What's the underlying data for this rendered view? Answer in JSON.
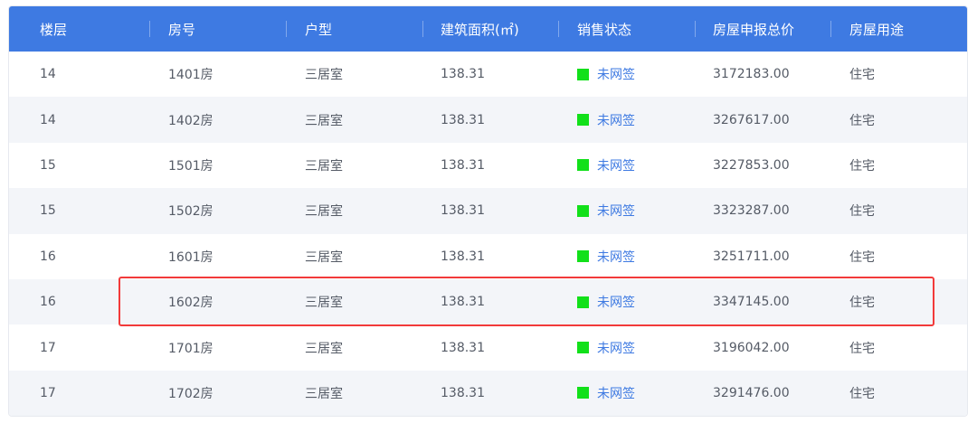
{
  "table": {
    "headers": [
      "楼层",
      "房号",
      "户型",
      "建筑面积(㎡)",
      "销售状态",
      "房屋申报总价",
      "房屋用途"
    ],
    "rows": [
      {
        "floor": "14",
        "room": "1401房",
        "layout": "三居室",
        "area": "138.31",
        "status": "未网签",
        "price": "3172183.00",
        "usage": "住宅"
      },
      {
        "floor": "14",
        "room": "1402房",
        "layout": "三居室",
        "area": "138.31",
        "status": "未网签",
        "price": "3267617.00",
        "usage": "住宅"
      },
      {
        "floor": "15",
        "room": "1501房",
        "layout": "三居室",
        "area": "138.31",
        "status": "未网签",
        "price": "3227853.00",
        "usage": "住宅"
      },
      {
        "floor": "15",
        "room": "1502房",
        "layout": "三居室",
        "area": "138.31",
        "status": "未网签",
        "price": "3323287.00",
        "usage": "住宅"
      },
      {
        "floor": "16",
        "room": "1601房",
        "layout": "三居室",
        "area": "138.31",
        "status": "未网签",
        "price": "3251711.00",
        "usage": "住宅"
      },
      {
        "floor": "16",
        "room": "1602房",
        "layout": "三居室",
        "area": "138.31",
        "status": "未网签",
        "price": "3347145.00",
        "usage": "住宅"
      },
      {
        "floor": "17",
        "room": "1701房",
        "layout": "三居室",
        "area": "138.31",
        "status": "未网签",
        "price": "3196042.00",
        "usage": "住宅"
      },
      {
        "floor": "17",
        "room": "1702房",
        "layout": "三居室",
        "area": "138.31",
        "status": "未网签",
        "price": "3291476.00",
        "usage": "住宅"
      }
    ]
  },
  "colors": {
    "header_bg": "#3e7ae2",
    "alt_row_bg": "#f3f5f9",
    "status_square": "#12e01a",
    "status_text": "#3e7ae2",
    "highlight_border": "#f23a3a"
  },
  "highlight": {
    "row": "1602房",
    "icon": "red-highlight-rectangle"
  }
}
